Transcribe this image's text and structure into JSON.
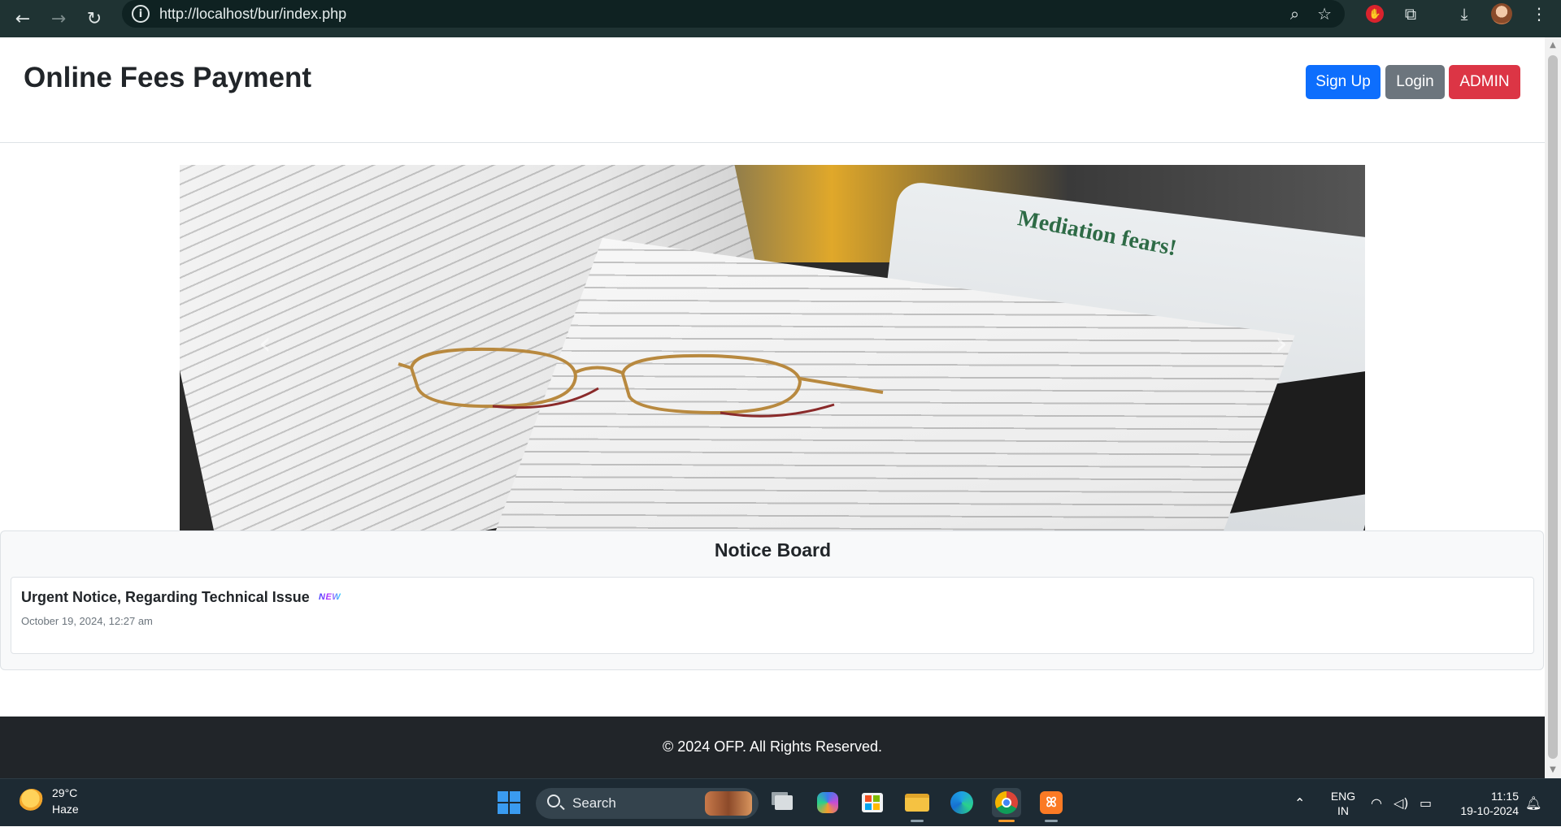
{
  "browser": {
    "url": "http://localhost/bur/index.php"
  },
  "site": {
    "title": "Online Fees Payment",
    "buttons": {
      "signup": "Sign Up",
      "login": "Login",
      "admin": "ADMIN"
    }
  },
  "notice_board": {
    "title": "Notice Board",
    "items": [
      {
        "heading": "Urgent Notice, Regarding Technical Issue",
        "badge": "NEW",
        "date": "October 19, 2024, 12:27 am"
      }
    ]
  },
  "carousel": {
    "headline": "Mediation fears!"
  },
  "footer": {
    "text": "© 2024 OFP. All Rights Reserved."
  },
  "taskbar": {
    "weather": {
      "temp": "29°C",
      "desc": "Haze"
    },
    "search_label": "Search",
    "lang": {
      "line1": "ENG",
      "line2": "IN"
    },
    "clock": {
      "time": "11:15",
      "date": "19-10-2024"
    }
  },
  "colors": {
    "signup": "#0d6efd",
    "login": "#6c757d",
    "admin": "#dc3545",
    "footer": "#212529",
    "chrome": "#1f3333"
  }
}
